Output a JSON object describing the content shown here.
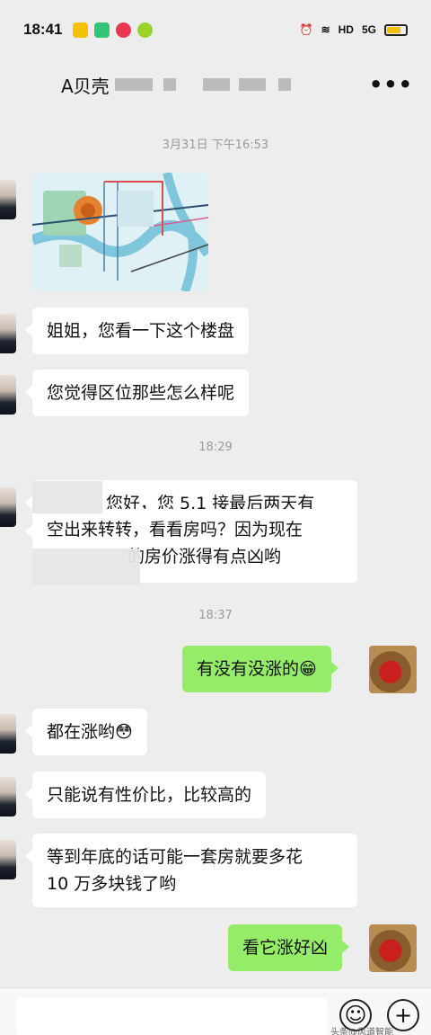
{
  "status": {
    "time": "18:41",
    "network": "HD",
    "signal": "5G"
  },
  "header": {
    "title": "A贝壳",
    "more": "•••"
  },
  "timestamps": [
    "3月31日 下午16:53",
    "18:29",
    "18:37"
  ],
  "messages": {
    "m1": "姐姐，您看一下这个楼盘",
    "m2": "您觉得区位那些怎么样呢",
    "m3_line1": "您好，您 5.1 接最后两天有",
    "m3_line2": "空出来转转，看看房吗？因为现在",
    "m3_line3": "的房价涨得有点凶哟",
    "m4": "有没有没涨的",
    "m5": "都在涨哟",
    "m6": "只能说有性价比，比较高的",
    "m7_line1": "等到年底的话可能一套房就要多花",
    "m7_line2": "10 万多块钱了哟",
    "m8": "看它涨好凶"
  },
  "emojis": {
    "grin": "😁",
    "flushed": "😳"
  },
  "composer": {
    "emoji_button": "☺",
    "plus_button": "+"
  },
  "watermark": "头条@风道智能"
}
